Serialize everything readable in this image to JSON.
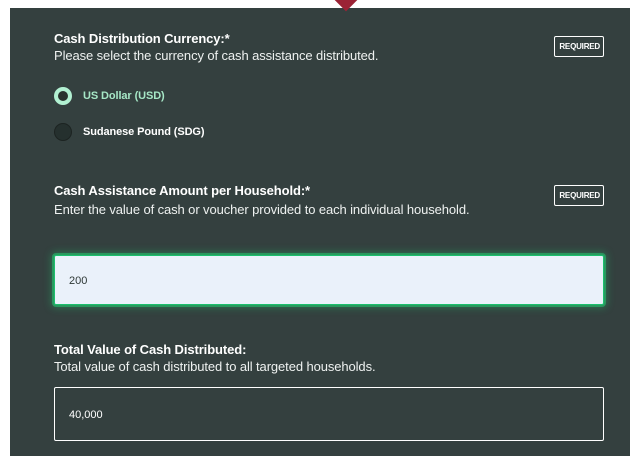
{
  "currency_question": {
    "title": "Cash Distribution Currency:*",
    "help": "Please select the currency of cash assistance distributed.",
    "required_badge": "REQUIRED",
    "options": [
      {
        "label": "US Dollar (USD)",
        "selected": true
      },
      {
        "label": "Sudanese Pound (SDG)",
        "selected": false
      }
    ]
  },
  "amount_question": {
    "title": "Cash Assistance Amount per Household:*",
    "help": "Enter the value of cash or voucher provided to each individual household.",
    "required_badge": "REQUIRED",
    "value": "200"
  },
  "total_question": {
    "title": "Total Value of Cash Distributed:",
    "help": "Total value of cash distributed to all targeted households.",
    "value": "40,000"
  },
  "colors": {
    "panel_background": "#34403f",
    "accent_caret": "#9b2335",
    "focus_ring": "#1bbf6d",
    "selected_option_text": "#a6e7c6",
    "focused_input_background": "#eaf1fa"
  }
}
